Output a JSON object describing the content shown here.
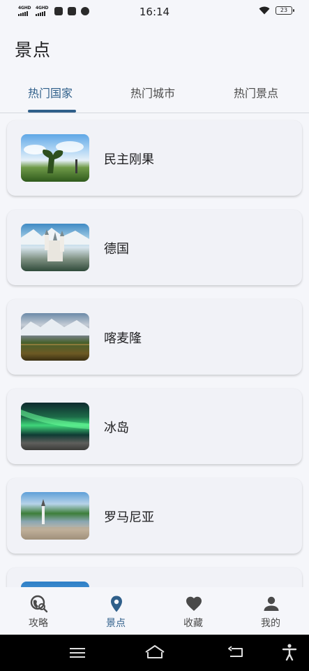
{
  "status": {
    "time": "16:14",
    "net1": "4GHD",
    "net2": "4GHD",
    "battery": "23"
  },
  "header": {
    "title": "景点"
  },
  "tabs": [
    {
      "label": "热门国家",
      "active": true
    },
    {
      "label": "热门城市",
      "active": false
    },
    {
      "label": "热门景点",
      "active": false
    }
  ],
  "countries": [
    {
      "name": "民主刚果"
    },
    {
      "name": "德国"
    },
    {
      "name": "喀麦隆"
    },
    {
      "name": "冰岛"
    },
    {
      "name": "罗马尼亚"
    }
  ],
  "bottom_nav": [
    {
      "label": "攻略",
      "icon": "travel-explore-icon",
      "active": false
    },
    {
      "label": "景点",
      "icon": "location-pin-icon",
      "active": true
    },
    {
      "label": "收藏",
      "icon": "heart-icon",
      "active": false
    },
    {
      "label": "我的",
      "icon": "person-icon",
      "active": false
    }
  ],
  "colors": {
    "accent": "#2f5f8a",
    "background": "#f5f6fa",
    "card": "#f1f2f7"
  }
}
